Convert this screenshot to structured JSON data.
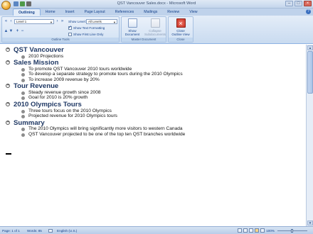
{
  "window": {
    "title": "QST Vancouver Sales.docx - Microsoft Word"
  },
  "tabs": [
    "Outlining",
    "Home",
    "Insert",
    "Page Layout",
    "References",
    "Mailings",
    "Review",
    "View"
  ],
  "ribbon": {
    "outline_tools": {
      "level_value": "Level 1",
      "show_level_label": "Show Level:",
      "show_level_value": "All Levels",
      "show_text_formatting": "Show Text Formatting",
      "show_text_formatting_checked": true,
      "show_first_line_only": "Show First Line Only",
      "show_first_line_only_checked": false,
      "group_label": "Outline Tools"
    },
    "master_document": {
      "show_document": "Show Document",
      "collapse_subdocuments": "Collapse Subdocuments",
      "group_label": "Master Document"
    },
    "close": {
      "close_outline_view": "Close Outline View",
      "group_label": "Close"
    }
  },
  "document": {
    "outline": [
      {
        "heading": "QST Vancouver",
        "items": [
          "2010 Projections"
        ]
      },
      {
        "heading": "Sales Mission",
        "items": [
          "To promote QST Vancouver 2010 tours worldwide",
          "To develop a separate strategy to promote tours during the 2010 Olympics",
          "To increase 2009 revenue by 20%"
        ]
      },
      {
        "heading": "Tour Revenue",
        "items": [
          "Steady revenue growth since 2008",
          "Goal for 2010 is 20% growth"
        ]
      },
      {
        "heading": "2010 Olympics Tours",
        "items": [
          "Three tours focus on the 2010 Olympics",
          "Projected revenue for 2010 Olympics tours"
        ]
      },
      {
        "heading": "Summary",
        "items": [
          "The 2010 Olympics will bring significantly more visitors to western Canada",
          "QST Vancouver projected to be one of the top ten QST branches worldwide"
        ]
      }
    ]
  },
  "status_bar": {
    "page": "Page: 1 of 1",
    "words": "Words: 85",
    "language": "English (U.S.)",
    "zoom": "100%"
  },
  "colors": {
    "heading": "#1f3864",
    "ribbon_text": "#15428b",
    "ribbon_bg": "#c9dbf0"
  }
}
